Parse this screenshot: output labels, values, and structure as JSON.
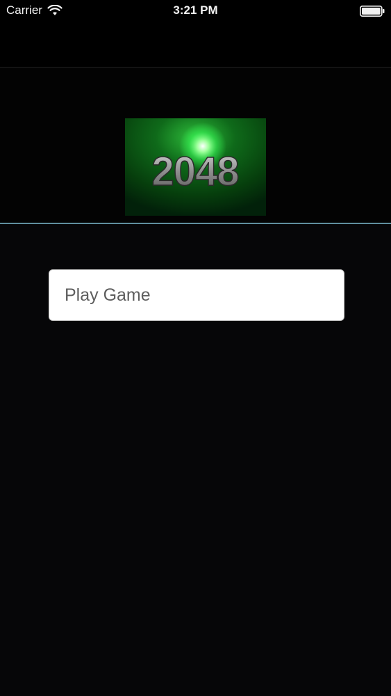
{
  "status_bar": {
    "carrier": "Carrier",
    "time": "3:21 PM",
    "wifi_icon": "wifi-icon",
    "battery_icon": "battery-icon"
  },
  "logo": {
    "text": "2048",
    "icon": "game-logo",
    "glow_color": "#39ff5a"
  },
  "main": {
    "play_button_label": "Play Game",
    "separator_color": "#5f8f9f",
    "background_color": "#060608"
  }
}
